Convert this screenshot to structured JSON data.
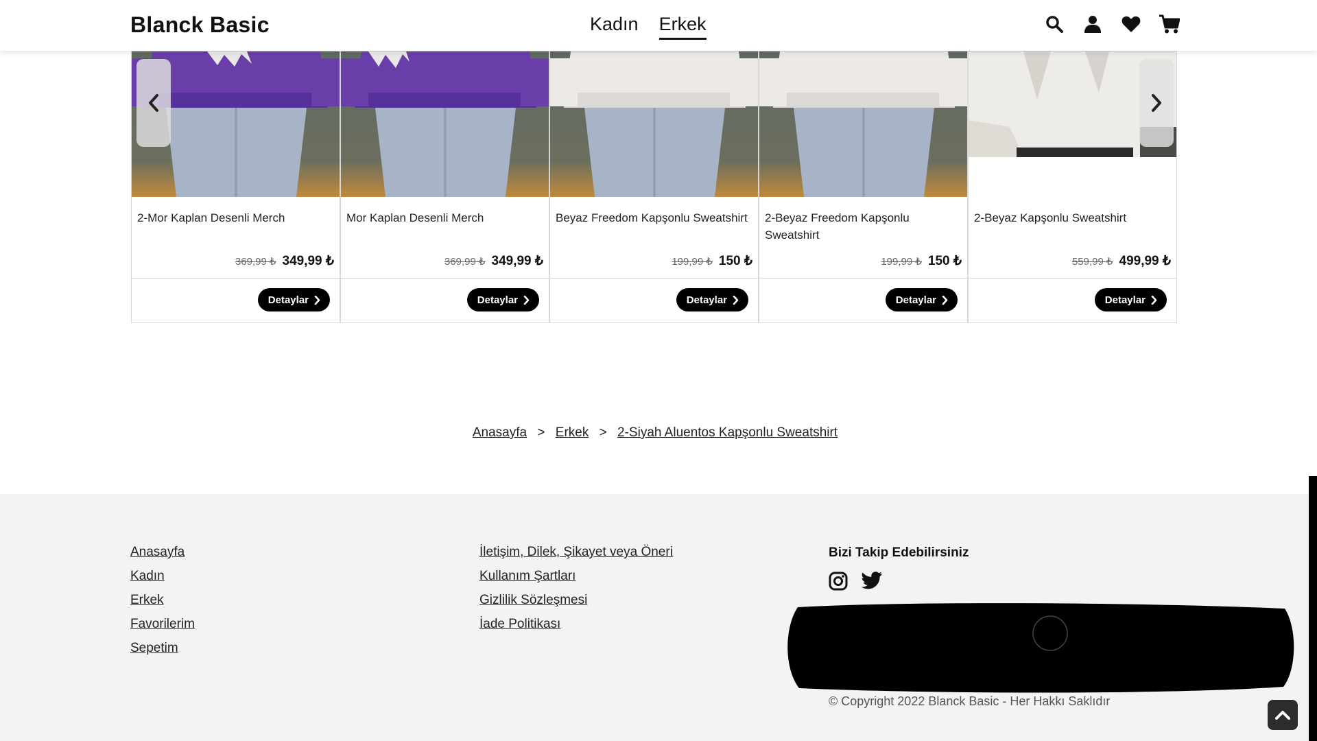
{
  "header": {
    "brand": "Blanck Basic",
    "nav": [
      {
        "label": "Kadın"
      },
      {
        "label": "Erkek"
      }
    ],
    "icons": [
      "search-icon",
      "user-icon",
      "heart-icon",
      "cart-icon"
    ]
  },
  "carousel": {
    "prev_icon": "chevron-left-icon",
    "next_icon": "chevron-right-icon",
    "products": [
      {
        "name": "2-Mor Kaplan Desenli Merch",
        "old_price": "369,99 ₺",
        "price": "349,99 ₺",
        "button": "Detaylar"
      },
      {
        "name": "Mor Kaplan Desenli Merch",
        "old_price": "369,99 ₺",
        "price": "349,99 ₺",
        "button": "Detaylar"
      },
      {
        "name": "Beyaz Freedom Kapşonlu Sweatshirt",
        "old_price": "199,99 ₺",
        "price": "150 ₺",
        "button": "Detaylar"
      },
      {
        "name": "2-Beyaz Freedom Kapşonlu Sweatshirt",
        "old_price": "199,99 ₺",
        "price": "150 ₺",
        "button": "Detaylar"
      },
      {
        "name": "2-Beyaz Kapşonlu Sweatshirt",
        "old_price": "559,99 ₺",
        "price": "499,99 ₺",
        "button": "Detaylar"
      }
    ]
  },
  "breadcrumb": {
    "items": [
      "Anasayfa",
      "Erkek",
      "2-Siyah Aluentos Kapşonlu Sweatshirt"
    ],
    "separator": ">"
  },
  "footer": {
    "col1": [
      "Anasayfa",
      "Kadın",
      "Erkek",
      "Favorilerim",
      "Sepetim"
    ],
    "col2": [
      "İletişim, Dilek, Şikayet veya Öneri",
      "Kullanım Şartları",
      "Gizlilik Sözleşmesi",
      "İade Politikası"
    ],
    "follow_title": "Bizi Takip Edebilirsiniz",
    "social": [
      "instagram-icon",
      "twitter-icon"
    ],
    "copyright": "© Copyright 2022 Blanck Basic - Her Hakkı Saklıdır"
  },
  "colors": {
    "purple_hoodie": "#6a3ea8",
    "white_hoodie": "#ece9e7",
    "jeans": "#a7b3c6",
    "footer_bg": "#f3f3f3",
    "button_bg": "#000000"
  }
}
